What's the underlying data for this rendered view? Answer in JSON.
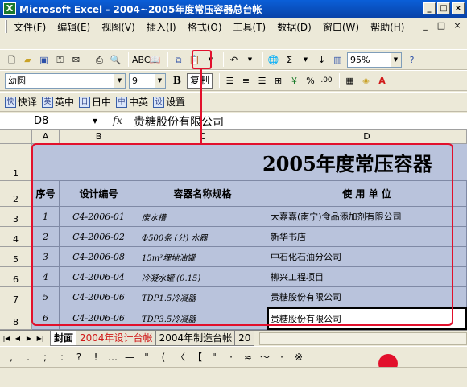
{
  "window": {
    "title": "Microsoft Excel - 2004~2005年度常压容器总台帐",
    "app_icon": "excel-icon",
    "controls": [
      "_",
      "□",
      "×"
    ]
  },
  "menu": [
    "文件(F)",
    "编辑(E)",
    "视图(V)",
    "插入(I)",
    "格式(O)",
    "工具(T)",
    "数据(D)",
    "窗口(W)",
    "帮助(H)"
  ],
  "mdi_controls": [
    "_",
    "□",
    "×"
  ],
  "toolbar1": {
    "zoom": "95%",
    "icons": [
      "new-icon",
      "open-icon",
      "save-icon",
      "permission-icon",
      "email-icon",
      "print-icon",
      "print-preview-icon",
      "spelling-icon",
      "research-icon",
      "cut-icon",
      "copy-icon",
      "paste-icon",
      "undo-icon",
      "hyperlink-icon",
      "autosum-icon",
      "sort-icon",
      "chart-icon",
      "help-icon"
    ]
  },
  "toolbar2": {
    "font": "幼圆",
    "size": "9",
    "bold": "B",
    "text_button": "复制"
  },
  "toolbar3": {
    "items": [
      {
        "label": "快译",
        "icon": "快"
      },
      {
        "label": "英中",
        "icon": "英"
      },
      {
        "label": "日中",
        "icon": "日"
      },
      {
        "label": "中英",
        "icon": "中"
      },
      {
        "label": "设置",
        "icon": "设"
      }
    ]
  },
  "formula_bar": {
    "name_box": "D8",
    "fx": "fx",
    "value": "贵糖股份有限公司"
  },
  "sheet": {
    "columns": [
      "A",
      "B",
      "C",
      "D"
    ],
    "rows": [
      "1",
      "2",
      "3",
      "4",
      "5",
      "6",
      "7",
      "8"
    ],
    "title": "2005年度常压容器",
    "headers": [
      "序号",
      "设计编号",
      "容器名称规格",
      "使  用  单  位"
    ],
    "data": [
      [
        "1",
        "C4-2006-01",
        "废水槽",
        "大嘉嘉(南宁)食品添加剂有限公司"
      ],
      [
        "2",
        "C4-2006-02",
        "Φ500条 (分) 水器",
        "新华书店"
      ],
      [
        "3",
        "C4-2006-08",
        "15m³埋地油罐",
        "中石化石油分公司"
      ],
      [
        "4",
        "C4-2006-04",
        "冷凝水罐 (0.15)",
        "柳兴工程项目"
      ],
      [
        "5",
        "C4-2006-06",
        "TDP1.5冷凝器",
        "贵糖股份有限公司"
      ],
      [
        "6",
        "C4-2006-06",
        "TDP3.5冷凝器",
        "贵糖股份有限公司"
      ]
    ]
  },
  "sheet_tabs": [
    {
      "label": "封面",
      "active": true,
      "red": false
    },
    {
      "label": "2004年设计台帐",
      "active": false,
      "red": true
    },
    {
      "label": "2004年制造台帐",
      "active": false,
      "red": false
    },
    {
      "label": "20",
      "active": false,
      "red": false
    }
  ],
  "symbol_bar": [
    ",",
    ".",
    ";",
    ":",
    "?",
    "!",
    "…",
    "—",
    "\"",
    "(",
    "〈",
    "【",
    "\"",
    "·",
    "≈",
    "～",
    "·",
    "※"
  ],
  "colors": {
    "title_bar": "#0a5fd8",
    "cell_fill": "#b9c3dc",
    "highlight": "#e2102c"
  }
}
